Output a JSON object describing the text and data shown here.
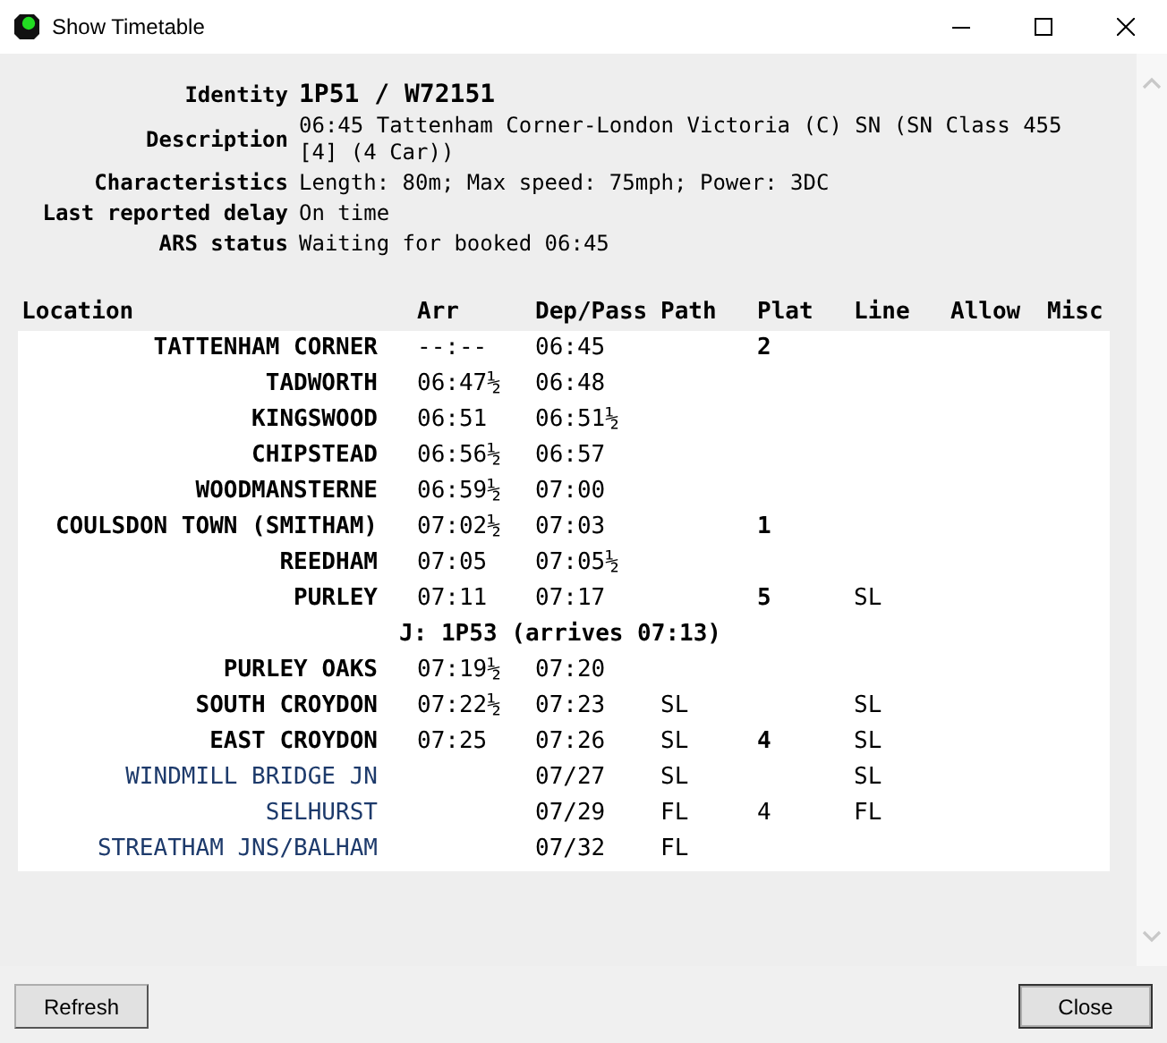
{
  "window": {
    "title": "Show Timetable"
  },
  "details": [
    {
      "label": "Identity",
      "value": "1P51 / W72151",
      "kind": "identity"
    },
    {
      "label": "Description",
      "value": "06:45 Tattenham Corner-London Victoria (C) SN (SN Class 455 [4] (4 Car))",
      "kind": "text"
    },
    {
      "label": "Characteristics",
      "value": "Length: 80m; Max speed: 75mph; Power: 3DC",
      "kind": "text"
    },
    {
      "label": "Last reported delay",
      "value": "On time",
      "kind": "text"
    },
    {
      "label": "ARS status",
      "value": "Waiting for booked 06:45",
      "kind": "text"
    }
  ],
  "table": {
    "columns": [
      "Location",
      "Arr",
      "Dep/Pass",
      "Path",
      "Plat",
      "Line",
      "Allow",
      "Misc"
    ],
    "rows": [
      {
        "kind": "stop",
        "location": "TATTENHAM CORNER",
        "arr": "--:--",
        "dep": "06:45",
        "plat": "2"
      },
      {
        "kind": "stop",
        "location": "TADWORTH",
        "arr": "06:47½",
        "dep": "06:48"
      },
      {
        "kind": "stop",
        "location": "KINGSWOOD",
        "arr": "06:51",
        "dep": "06:51½"
      },
      {
        "kind": "stop",
        "location": "CHIPSTEAD",
        "arr": "06:56½",
        "dep": "06:57"
      },
      {
        "kind": "stop",
        "location": "WOODMANSTERNE",
        "arr": "06:59½",
        "dep": "07:00"
      },
      {
        "kind": "stop",
        "location": "COULSDON TOWN (SMITHAM)",
        "arr": "07:02½",
        "dep": "07:03",
        "plat": "1"
      },
      {
        "kind": "stop",
        "location": "REEDHAM",
        "arr": "07:05",
        "dep": "07:05½"
      },
      {
        "kind": "stop",
        "location": "PURLEY",
        "arr": "07:11",
        "dep": "07:17",
        "plat": "5",
        "line": "SL"
      },
      {
        "kind": "join",
        "text": "J: 1P53 (arrives 07:13)"
      },
      {
        "kind": "stop",
        "location": "PURLEY OAKS",
        "arr": "07:19½",
        "dep": "07:20"
      },
      {
        "kind": "stop",
        "location": "SOUTH CROYDON",
        "arr": "07:22½",
        "dep": "07:23",
        "path": "SL",
        "line": "SL"
      },
      {
        "kind": "stop",
        "location": "EAST CROYDON",
        "arr": "07:25",
        "dep": "07:26",
        "path": "SL",
        "plat": "4",
        "line": "SL"
      },
      {
        "kind": "pass",
        "location": "WINDMILL BRIDGE JN",
        "dep": "07/27",
        "path": "SL",
        "line": "SL"
      },
      {
        "kind": "pass",
        "location": "SELHURST",
        "dep": "07/29",
        "path": "FL",
        "plat": "4",
        "line": "FL"
      },
      {
        "kind": "pass",
        "location": "STREATHAM JNS/BALHAM",
        "dep": "07/32",
        "path": "FL"
      }
    ]
  },
  "buttons": [
    {
      "label": "Refresh"
    },
    {
      "label": "Close"
    }
  ]
}
